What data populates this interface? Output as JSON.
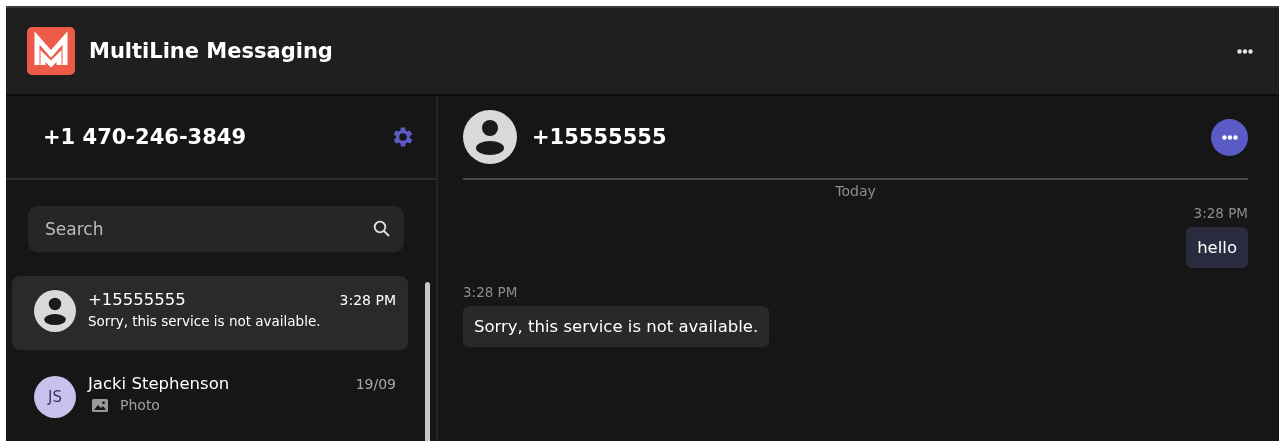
{
  "app": {
    "title": "MultiLine Messaging"
  },
  "account": {
    "phone": "+1 470-246-3849"
  },
  "search": {
    "placeholder": "Search"
  },
  "conversations": [
    {
      "avatar": {
        "kind": "silhouette"
      },
      "name": "+15555555",
      "time": "3:28 PM",
      "preview": {
        "kind": "text",
        "text": "Sorry, this service is not available."
      },
      "selected": true
    },
    {
      "avatar": {
        "kind": "initials",
        "initials": "JS"
      },
      "name": "Jacki Stephenson",
      "time": "19/09",
      "preview": {
        "kind": "photo",
        "text": "Photo"
      },
      "selected": false
    }
  ],
  "chat": {
    "contact": "+15555555",
    "date_divider": "Today",
    "messages": [
      {
        "kind": "outgoing",
        "time": "3:28 PM",
        "text": "hello"
      },
      {
        "kind": "incoming",
        "time": "3:28 PM",
        "text": "Sorry, this service is not available."
      }
    ]
  }
}
